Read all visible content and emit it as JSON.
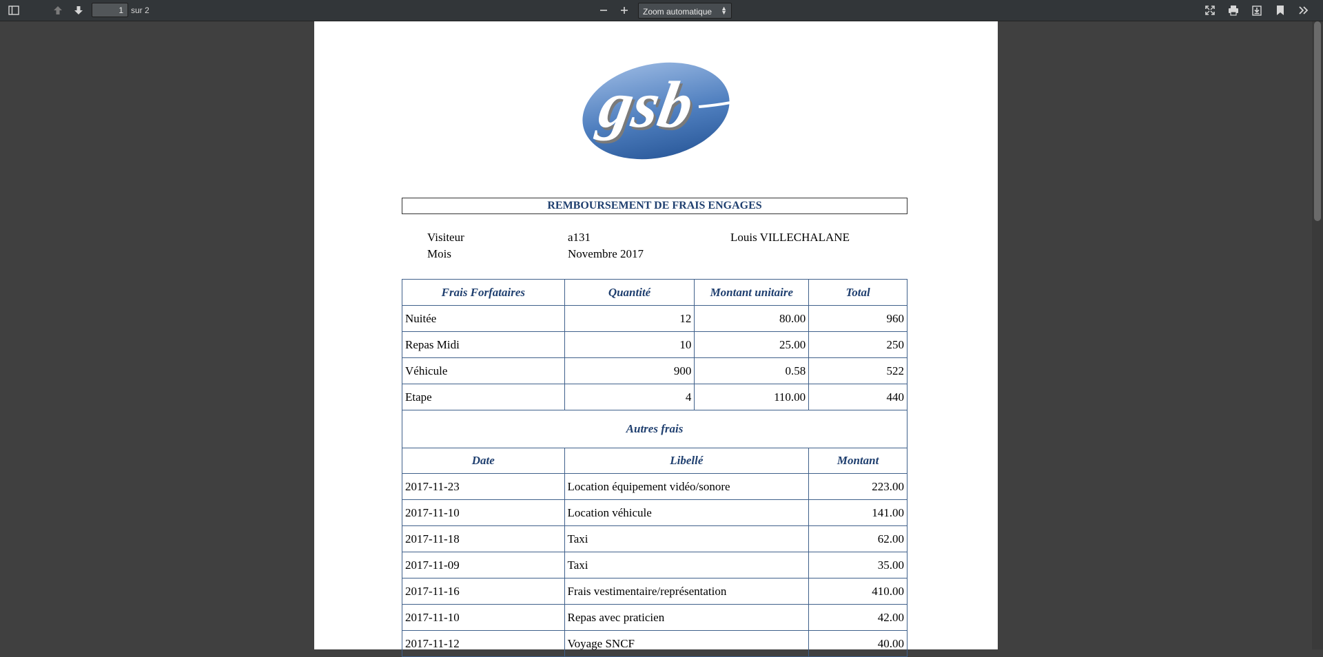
{
  "toolbar": {
    "page_current": "1",
    "page_total": "sur 2",
    "zoom": "Zoom automatique",
    "icons": [
      "sidebar-toggle-icon",
      "previous-page-icon",
      "next-page-icon",
      "zoom-out-icon",
      "zoom-in-icon",
      "presentation-mode-icon",
      "print-icon",
      "download-icon",
      "bookmark-icon",
      "tools-icon"
    ]
  },
  "document": {
    "logo_text": "gsb",
    "title": "REMBOURSEMENT DE FRAIS ENGAGES",
    "visiteur_label": "Visiteur",
    "visiteur_id": "a131",
    "visiteur_name": "Louis VILLECHALANE",
    "mois_label": "Mois",
    "mois_value": "Novembre 2017",
    "forfait_headers": [
      "Frais Forfataires",
      "Quantité",
      "Montant unitaire",
      "Total"
    ],
    "forfait_rows": [
      {
        "label": "Nuitée",
        "qty": "12",
        "unit": "80.00",
        "total": "960"
      },
      {
        "label": "Repas Midi",
        "qty": "10",
        "unit": "25.00",
        "total": "250"
      },
      {
        "label": "Véhicule",
        "qty": "900",
        "unit": "0.58",
        "total": "522"
      },
      {
        "label": "Etape",
        "qty": "4",
        "unit": "110.00",
        "total": "440"
      }
    ],
    "autres_title": "Autres frais",
    "autres_headers": [
      "Date",
      "Libellé",
      "Montant"
    ],
    "autres_rows": [
      {
        "date": "2017-11-23",
        "libelle": "Location équipement vidéo/sonore",
        "montant": "223.00"
      },
      {
        "date": "2017-11-10",
        "libelle": "Location véhicule",
        "montant": "141.00"
      },
      {
        "date": "2017-11-18",
        "libelle": "Taxi",
        "montant": "62.00"
      },
      {
        "date": "2017-11-09",
        "libelle": "Taxi",
        "montant": "35.00"
      },
      {
        "date": "2017-11-16",
        "libelle": "Frais vestimentaire/représentation",
        "montant": "410.00"
      },
      {
        "date": "2017-11-10",
        "libelle": "Repas avec praticien",
        "montant": "42.00"
      },
      {
        "date": "2017-11-12",
        "libelle": "Voyage SNCF",
        "montant": "40.00"
      }
    ]
  },
  "colors": {
    "toolbar_bg": "#323639",
    "viewer_bg": "#404040",
    "header_text": "#1f3f6f",
    "table_border": "#3e5f8a",
    "logo_blue": "#4f7fbf"
  }
}
